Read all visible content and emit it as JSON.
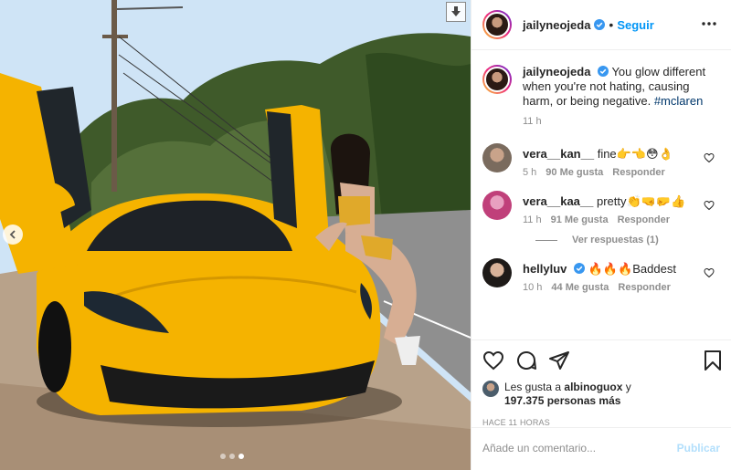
{
  "post": {
    "username": "jailyneojeda",
    "follow_label": "Seguir",
    "follow_separator": "•",
    "caption_text": "You glow different when you're not hating, causing harm, or being negative.",
    "caption_hashtag": "#mclaren",
    "caption_time": "11 h"
  },
  "comments": [
    {
      "username": "vera__kan__",
      "text": "fine👉👈😳👌",
      "time": "5 h",
      "likes": "90 Me gusta",
      "reply_label": "Responder"
    },
    {
      "username": "vera__kaa__",
      "text": "pretty👏🤜🤛👍",
      "time": "11 h",
      "likes": "91 Me gusta",
      "reply_label": "Responder",
      "view_replies": "Ver respuestas (1)"
    },
    {
      "username": "hellyluv",
      "text": "🔥🔥🔥Baddest",
      "time": "10 h",
      "likes": "44 Me gusta",
      "reply_label": "Responder"
    }
  ],
  "likes_line": {
    "prefix": "Les gusta a",
    "user": "albinoguox",
    "suffix": "y",
    "count": "197.375 personas más"
  },
  "posted_ago": "HACE 11 HORAS",
  "comment_box": {
    "placeholder": "Añade un comentario...",
    "publish_label": "Publicar"
  },
  "colors": {
    "accent": "#0095f6",
    "car_yellow": "#f5b300",
    "publish_disabled": "#b2dffc"
  },
  "icons": [
    "download-icon",
    "chevron-left-icon",
    "verified-icon",
    "more-icon",
    "heart-icon",
    "comment-icon",
    "share-icon",
    "bookmark-icon"
  ]
}
